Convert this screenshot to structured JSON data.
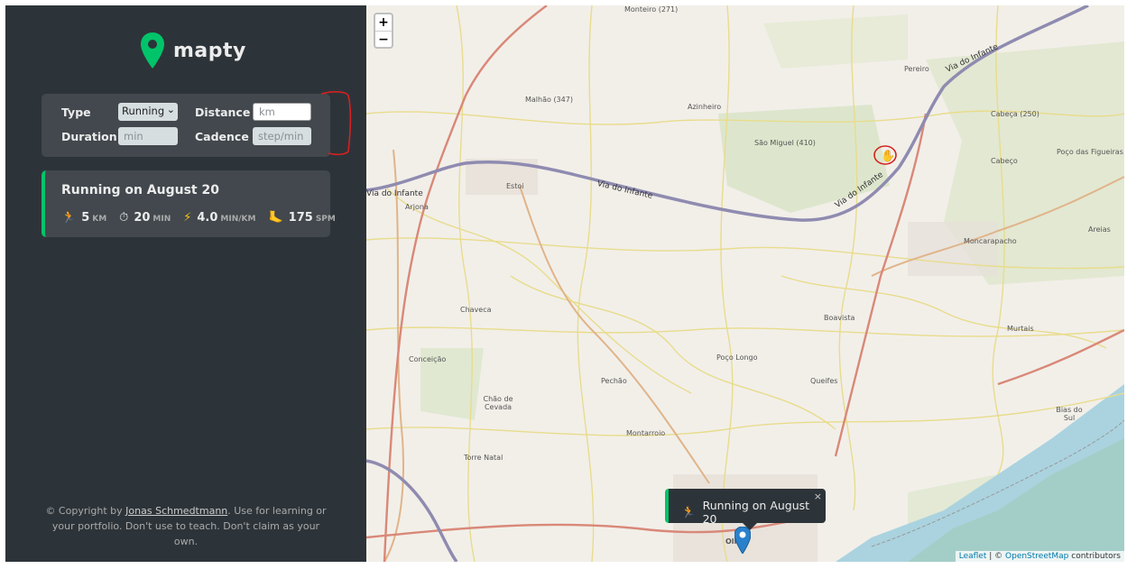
{
  "logo": {
    "text": "mapty",
    "brand_color": "#00c46a"
  },
  "form": {
    "type_label": "Type",
    "type_value": "Running",
    "distance_label": "Distance",
    "distance_placeholder": "km",
    "duration_label": "Duration",
    "duration_placeholder": "min",
    "cadence_label": "Cadence",
    "cadence_placeholder": "step/min"
  },
  "workouts": [
    {
      "title": "Running on August 20",
      "details": [
        {
          "icon": "🏃",
          "icon_name": "runner-icon",
          "value": "5",
          "unit": "KM"
        },
        {
          "icon": "⏱",
          "icon_name": "stopwatch-icon",
          "value": "20",
          "unit": "MIN"
        },
        {
          "icon": "⚡",
          "icon_name": "lightning-icon",
          "value": "4.0",
          "unit": "MIN/KM"
        },
        {
          "icon": "🦶",
          "icon_name": "footprint-icon",
          "value": "175",
          "unit": "SPM"
        }
      ]
    }
  ],
  "copyright": {
    "prefix": "© Copyright by ",
    "author": "Jonas Schmedtmann",
    "suffix": ". Use for learning or your portfolio. Don't use to teach. Don't claim as your own."
  },
  "map": {
    "zoom_in": "+",
    "zoom_out": "−",
    "places": [
      "Monteiro (271)",
      "Malhão (347)",
      "Azinheiro",
      "São Miguel (410)",
      "Cabeça (250)",
      "Poço das Figueiras",
      "Cabeço",
      "Estoi",
      "Arjona",
      "Moncarapacho",
      "Areias",
      "Chaveca",
      "Boavista",
      "Murtais",
      "Conceição",
      "Pechão",
      "Poço Longo",
      "Queifes",
      "Chão de Cevada",
      "Montarroio",
      "Bias do Sul",
      "Torre Natal",
      "Olhão",
      "Pereiro"
    ],
    "roads": [
      "Via do Infante",
      "Via do Infante",
      "Via do Infante",
      "Via do Infante"
    ],
    "popup": {
      "icon": "🏃",
      "text": "Running on August 20",
      "close": "×"
    },
    "attribution": {
      "leaflet": "Leaflet",
      "sep": " | © ",
      "osm": "OpenStreetMap",
      "tail": " contributors"
    }
  }
}
